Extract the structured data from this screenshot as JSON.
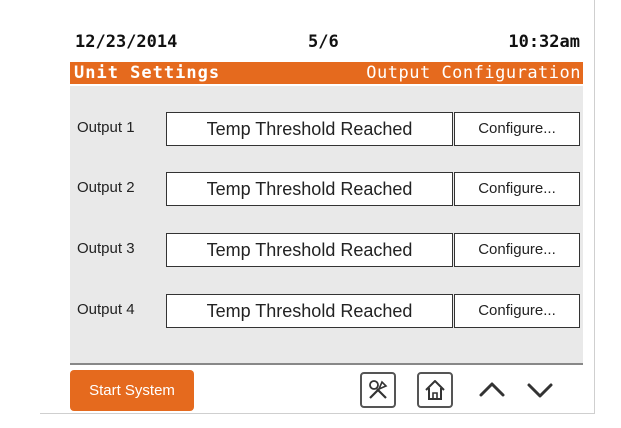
{
  "status": {
    "date": "12/23/2014",
    "page": "5/6",
    "time": "10:32am"
  },
  "title": {
    "left": "Unit Settings",
    "right": "Output Configuration"
  },
  "outputs": [
    {
      "label": "Output 1",
      "value": "Temp Threshold Reached",
      "configure_label": "Configure..."
    },
    {
      "label": "Output 2",
      "value": "Temp Threshold Reached",
      "configure_label": "Configure..."
    },
    {
      "label": "Output 3",
      "value": "Temp Threshold Reached",
      "configure_label": "Configure..."
    },
    {
      "label": "Output 4",
      "value": "Temp Threshold Reached",
      "configure_label": "Configure..."
    }
  ],
  "footer": {
    "start_label": "Start System",
    "icons": [
      "tools-icon",
      "home-icon",
      "chevron-up-icon",
      "chevron-down-icon"
    ]
  },
  "colors": {
    "accent": "#e56a1e",
    "content_bg": "#e9e9e9"
  }
}
